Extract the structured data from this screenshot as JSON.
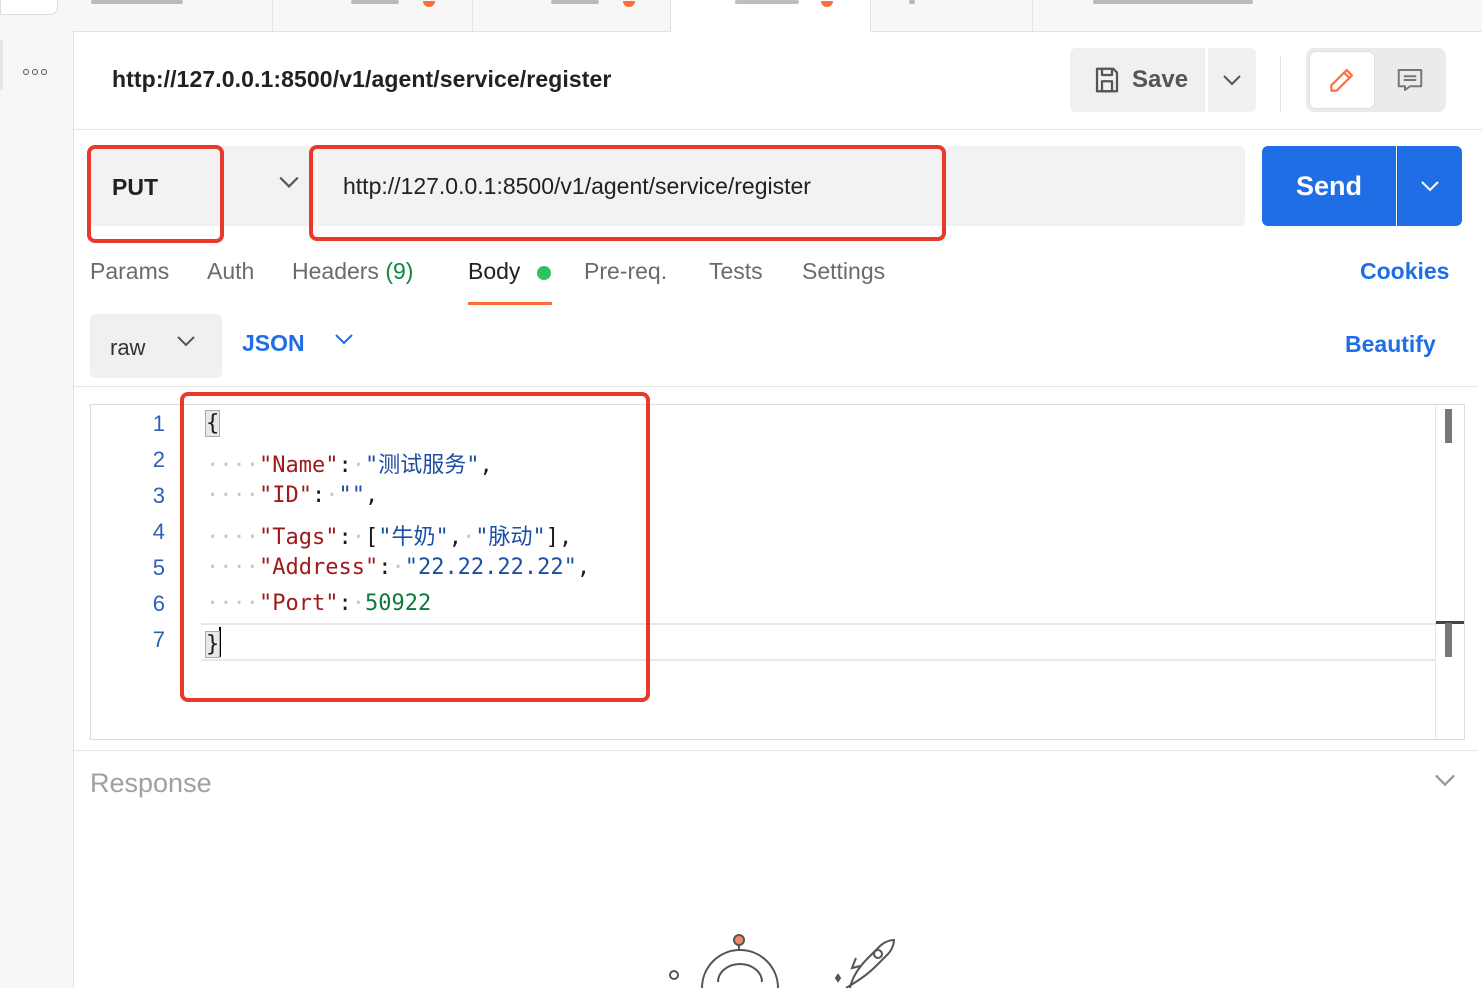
{
  "request": {
    "title": "http://127.0.0.1:8500/v1/agent/service/register",
    "method": "PUT",
    "url": "http://127.0.0.1:8500/v1/agent/service/register"
  },
  "header_actions": {
    "save_label": "Save"
  },
  "send": {
    "label": "Send"
  },
  "request_tabs": [
    {
      "label": "Params"
    },
    {
      "label": "Auth"
    },
    {
      "label": "Headers",
      "count": "(9)"
    },
    {
      "label": "Body",
      "active": true
    },
    {
      "label": "Pre-req."
    },
    {
      "label": "Tests"
    },
    {
      "label": "Settings"
    }
  ],
  "cookies_label": "Cookies",
  "body": {
    "mode": "raw",
    "language": "JSON",
    "beautify_label": "Beautify",
    "line_numbers": [
      "1",
      "2",
      "3",
      "4",
      "5",
      "6",
      "7"
    ],
    "json": {
      "open_brace": "{",
      "close_brace": "}",
      "name_key": "\"Name\"",
      "name_value": "\"测试服务\"",
      "id_key": "\"ID\"",
      "id_value": "\"\"",
      "tags_key": "\"Tags\"",
      "tag_1": "\"牛奶\"",
      "tag_2": "\"脉动\"",
      "address_key": "\"Address\"",
      "address_value": "\"22.22.22.22\"",
      "port_key": "\"Port\"",
      "port_value": "50922"
    }
  },
  "response": {
    "title": "Response"
  },
  "colors": {
    "accent_blue": "#1f6ee6",
    "annotation_red": "#e8392c",
    "tab_indicator_orange": "#ff6c37",
    "status_green": "#2ec160"
  }
}
